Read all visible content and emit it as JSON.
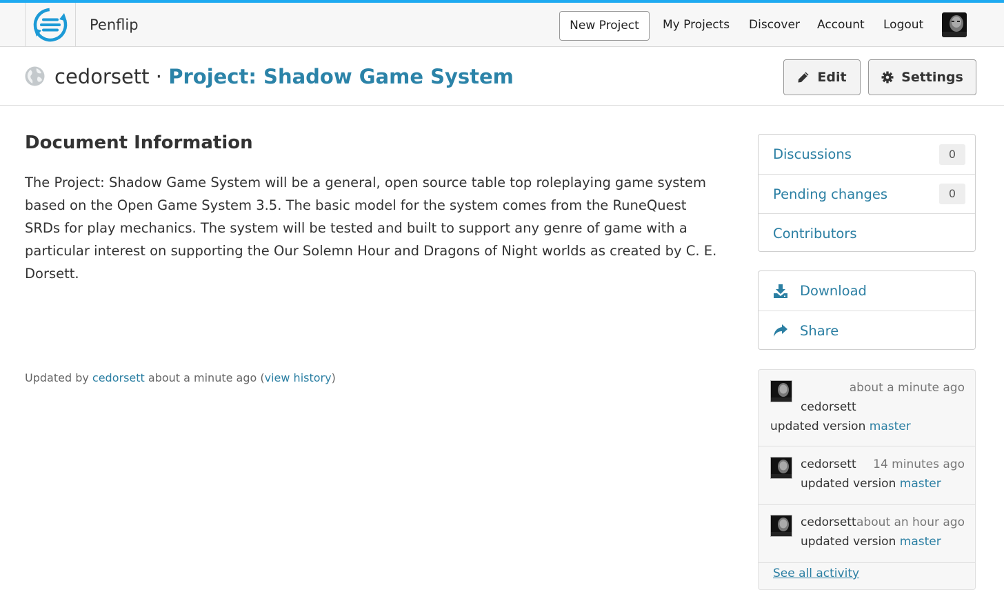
{
  "navbar": {
    "brand": "Penflip",
    "new_project": "New Project",
    "links": [
      "My Projects",
      "Discover",
      "Account",
      "Logout"
    ]
  },
  "header": {
    "owner": "cedorsett",
    "separator": "·",
    "project_title": "Project: Shadow Game System",
    "edit_label": "Edit",
    "settings_label": "Settings"
  },
  "main": {
    "heading": "Document Information",
    "description": "The Project: Shadow Game System will be a general, open source table top roleplaying game system based on the Open Game System 3.5. The basic model for the system comes from the RuneQuest SRDs for play mechanics. The system will be tested and built to support any genre of game with a particular interest on supporting the Our Solemn Hour and Dragons of Night worlds as created by C. E. Dorsett.",
    "updated": {
      "prefix": "Updated by ",
      "user": "cedorsett",
      "middle": " about a minute ago (",
      "history_link": "view history",
      "suffix": ")"
    }
  },
  "sidebar": {
    "discussions": {
      "label": "Discussions",
      "count": "0"
    },
    "pending": {
      "label": "Pending changes",
      "count": "0"
    },
    "contributors": "Contributors",
    "download": "Download",
    "share": "Share",
    "activity": [
      {
        "user": "cedorsett",
        "time": "about a minute ago",
        "text": "updated version ",
        "version": "master"
      },
      {
        "user": "cedorsett",
        "time": "14 minutes ago",
        "text": "updated version ",
        "version": "master"
      },
      {
        "user": "cedorsett",
        "time": "about an hour ago",
        "text": "updated version ",
        "version": "master"
      }
    ],
    "see_all": "See all activity"
  },
  "colors": {
    "accent": "#2b7fa3",
    "top_stripe": "#1eaaf1",
    "logo": "#1c9ad6"
  },
  "icons": [
    "penflip-logo-icon",
    "globe-icon",
    "pencil-icon",
    "gear-icon",
    "download-icon",
    "share-icon",
    "avatar"
  ]
}
